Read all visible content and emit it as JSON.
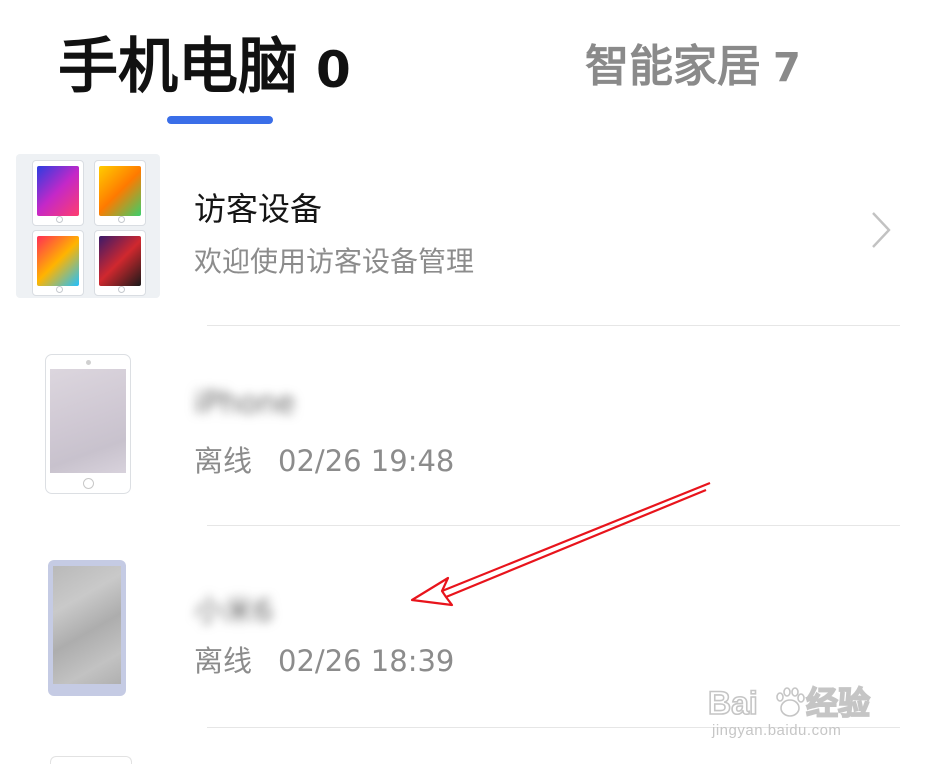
{
  "tabs": [
    {
      "label": "手机电脑",
      "count": "0",
      "active": true
    },
    {
      "label": "智能家居",
      "count": "7",
      "active": false
    }
  ],
  "accent_color": "#3a6ee8",
  "annotation_arrow_color": "#e8141c",
  "guest": {
    "title": "访客设备",
    "subtitle": "欢迎使用访客设备管理",
    "icon": "tablet-collection-icon",
    "tile_colors": [
      "#8a2be2",
      "#ffb000",
      "#ff2d55",
      "#b02020"
    ]
  },
  "devices": [
    {
      "name": "iPhone",
      "status": "离线",
      "time": "02/26 19:48",
      "icon": "tablet-icon"
    },
    {
      "name": "小米6",
      "status": "离线",
      "time": "02/26 18:39",
      "icon": "phone-icon"
    }
  ],
  "watermark": {
    "brand": "Baidu经验",
    "url": "jingyan.baidu.com"
  }
}
